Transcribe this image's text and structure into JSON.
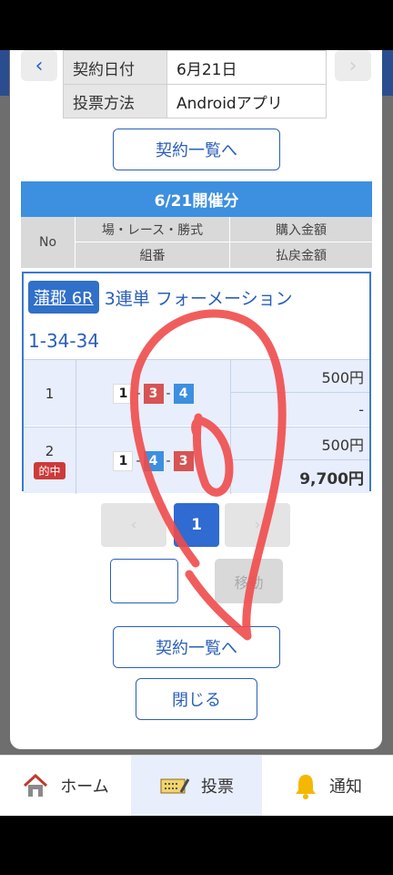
{
  "contract": {
    "date_label": "契約日付",
    "date_value": "6月21日",
    "method_label": "投票方法",
    "method_value": "Androidアプリ"
  },
  "nav": {
    "prev": "‹",
    "next": "›"
  },
  "buttons": {
    "contract_list": "契約一覧へ",
    "close": "閉じる",
    "move": "移動"
  },
  "section": {
    "header": "6/21開催分",
    "columns": {
      "no": "No",
      "race": "場・レース・勝式",
      "purchase": "購入金額",
      "combo": "組番",
      "payout": "払戻金額"
    }
  },
  "bet": {
    "venue": "蒲郡 6R",
    "bet_type": "3連単 フォーメーション",
    "combination": "1-34-34",
    "rows": [
      {
        "no": "1",
        "boats": [
          "1",
          "3",
          "4"
        ],
        "amount": "500円",
        "payout": "-",
        "hit": ""
      },
      {
        "no": "2",
        "boats": [
          "1",
          "4",
          "3"
        ],
        "amount": "500円",
        "payout": "9,700円",
        "hit": "的中"
      }
    ]
  },
  "pagination": {
    "prev": "‹",
    "current": "1",
    "next": "›"
  },
  "tabs": [
    {
      "label": "ホーム",
      "icon": "home-icon"
    },
    {
      "label": "投票",
      "icon": "ticket-icon"
    },
    {
      "label": "通知",
      "icon": "bell-icon"
    }
  ],
  "colors": {
    "primary": "#2a5fb8",
    "header_blue": "#3d8fdf",
    "hit_red": "#cc3b3b",
    "scribble": "#ef4b4b"
  }
}
